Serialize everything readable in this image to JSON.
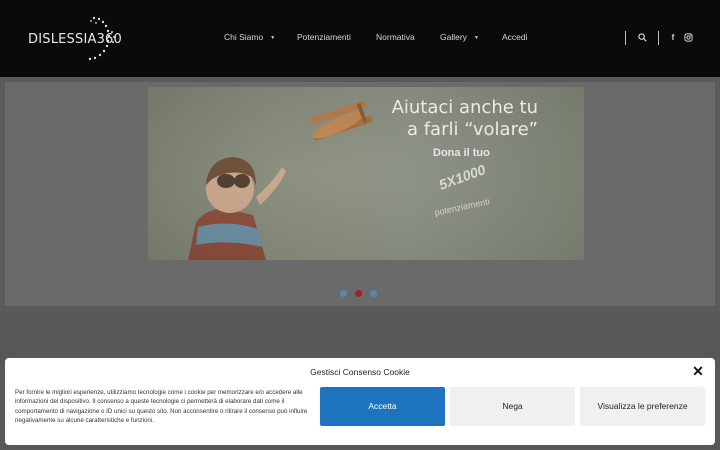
{
  "header": {
    "logo_text": "DISLESSIA360",
    "nav": [
      {
        "label": "Chi Siamo",
        "dropdown": true
      },
      {
        "label": "Potenziamenti",
        "dropdown": false
      },
      {
        "label": "Normativa",
        "dropdown": false
      },
      {
        "label": "Gallery",
        "dropdown": true
      },
      {
        "label": "Accedi",
        "dropdown": false
      }
    ],
    "icons": [
      "search-icon",
      "facebook-icon",
      "instagram-icon"
    ]
  },
  "slider": {
    "headline_line1": "Aiutaci anche tu",
    "headline_line2": "a farli “volare”",
    "sub": "Dona  il  tuo",
    "badge": "5X1000",
    "tag": "potenziamenti",
    "dots_total": 3,
    "active_dot": 2,
    "dot_color": "#5c88a8",
    "dot_active_color": "#a61e1e"
  },
  "cookie": {
    "title": "Gestisci Consenso Cookie",
    "text": "Per fornire le migliori esperienze, utilizziamo tecnologie come i cookie per memorizzare e/o accedere alle informazioni del dispositivo. Il consenso a queste tecnologie ci permetterà di elaborare dati come il comportamento di navigazione o ID unici su questo sito. Non acconsentire o ritirare il consenso può influire negativamente su alcune caratteristiche e funzioni.",
    "accept": "Accetta",
    "deny": "Nega",
    "prefs": "Visualizza le preferenze",
    "accent": "#1e73be"
  }
}
